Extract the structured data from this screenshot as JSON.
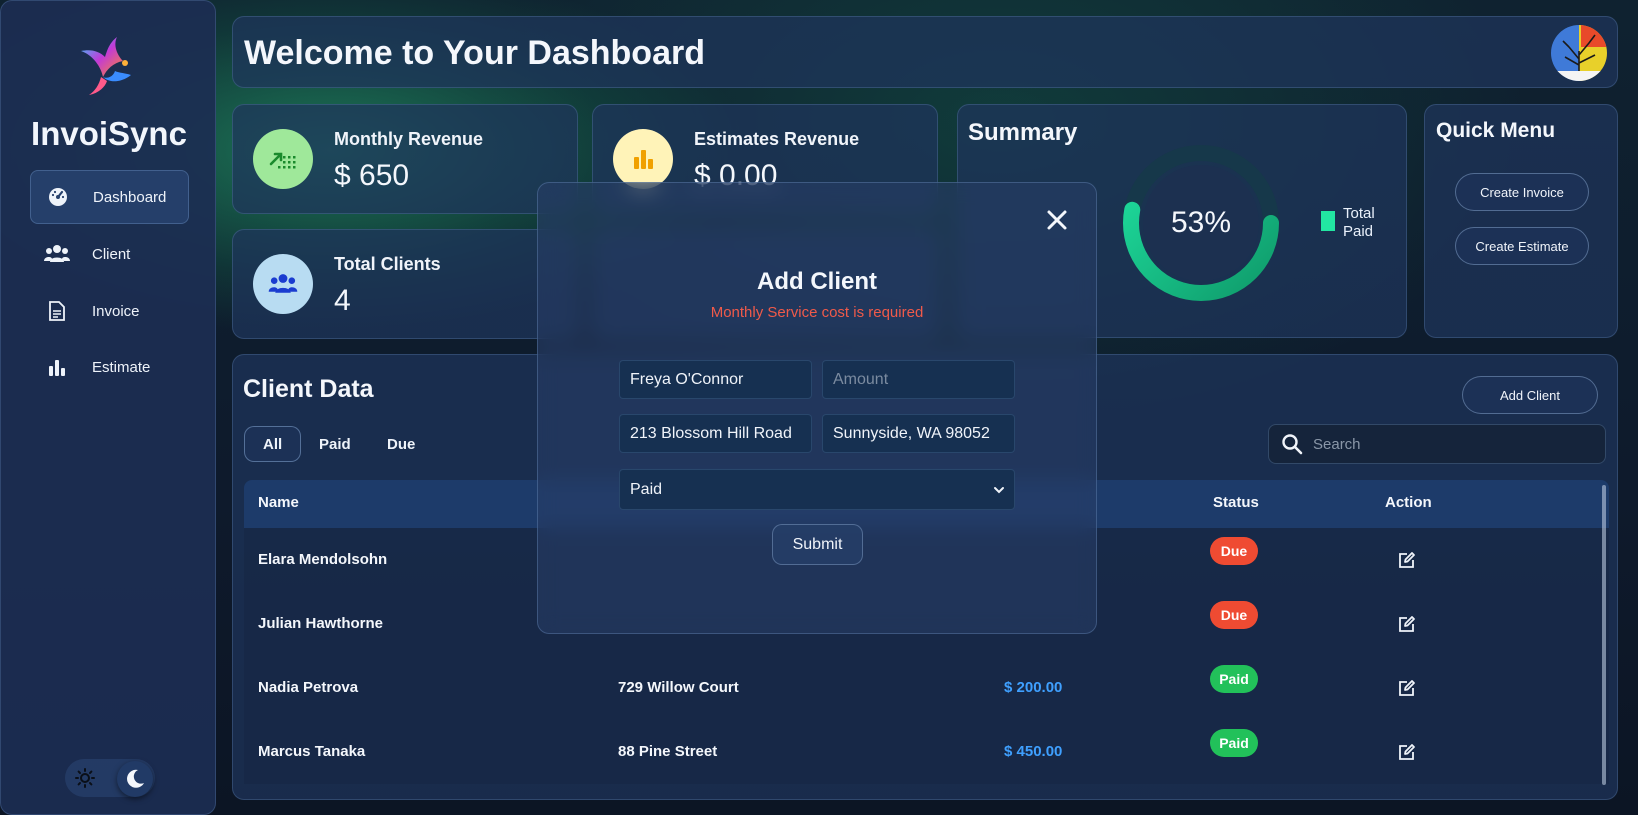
{
  "app": {
    "brand": "InvoiSync"
  },
  "sidebar": {
    "items": [
      {
        "label": "Dashboard",
        "icon": "gauge-icon",
        "active": true
      },
      {
        "label": "Client",
        "icon": "users-icon",
        "active": false
      },
      {
        "label": "Invoice",
        "icon": "document-icon",
        "active": false
      },
      {
        "label": "Estimate",
        "icon": "bar-chart-icon",
        "active": false
      }
    ],
    "theme_toggle": {
      "light_icon": "sun-icon",
      "dark_icon": "moon-icon",
      "selected": "dark"
    }
  },
  "header": {
    "title": "Welcome to Your Dashboard"
  },
  "stats": [
    {
      "title": "Monthly Revenue",
      "value": "$ 650",
      "icon": "trend-up-icon",
      "circle_color": "#9fe89a",
      "icon_color": "#1a8a2c"
    },
    {
      "title": "Estimates Revenue",
      "value": "$ 0.00",
      "icon": "bar-chart-icon",
      "circle_color": "#fff3b8",
      "icon_color": "#f0a000"
    },
    {
      "title": "Total Clients",
      "value": "4",
      "icon": "users-icon",
      "circle_color": "#b8dcf2",
      "icon_color": "#1a3cd0"
    }
  ],
  "summary": {
    "title": "Summary",
    "percent_label": "53%",
    "percent": 53,
    "legend": "Total Paid",
    "legend_color": "#22e6a2"
  },
  "quick_menu": {
    "title": "Quick Menu",
    "buttons": [
      "Create Invoice",
      "Create Estimate"
    ]
  },
  "client_data": {
    "title": "Client Data",
    "filters": [
      "All",
      "Paid",
      "Due"
    ],
    "active_filter": "All",
    "add_button": "Add Client",
    "search_placeholder": "Search",
    "columns": {
      "name": "Name",
      "status": "Status",
      "action": "Action"
    },
    "rows": [
      {
        "name": "Elara Mendolsohn",
        "address": "",
        "amount": "",
        "status": "Due"
      },
      {
        "name": "Julian Hawthorne",
        "address": "",
        "amount": "",
        "status": "Due"
      },
      {
        "name": "Nadia Petrova",
        "address": "729 Willow Court",
        "amount": "$ 200.00",
        "status": "Paid"
      },
      {
        "name": "Marcus Tanaka",
        "address": "88 Pine Street",
        "amount": "$ 450.00",
        "status": "Paid"
      }
    ]
  },
  "modal": {
    "title": "Add Client",
    "error": "Monthly Service cost is required",
    "name_value": "Freya O'Connor",
    "amount_placeholder": "Amount",
    "address_value": "213 Blossom Hill Road",
    "city_value": "Sunnyside, WA 98052",
    "status_value": "Paid",
    "submit_label": "Submit"
  },
  "colors": {
    "due": "#ef4b32",
    "paid": "#22c15a",
    "amount": "#3fa0ff",
    "accent": "#22e6a2"
  }
}
